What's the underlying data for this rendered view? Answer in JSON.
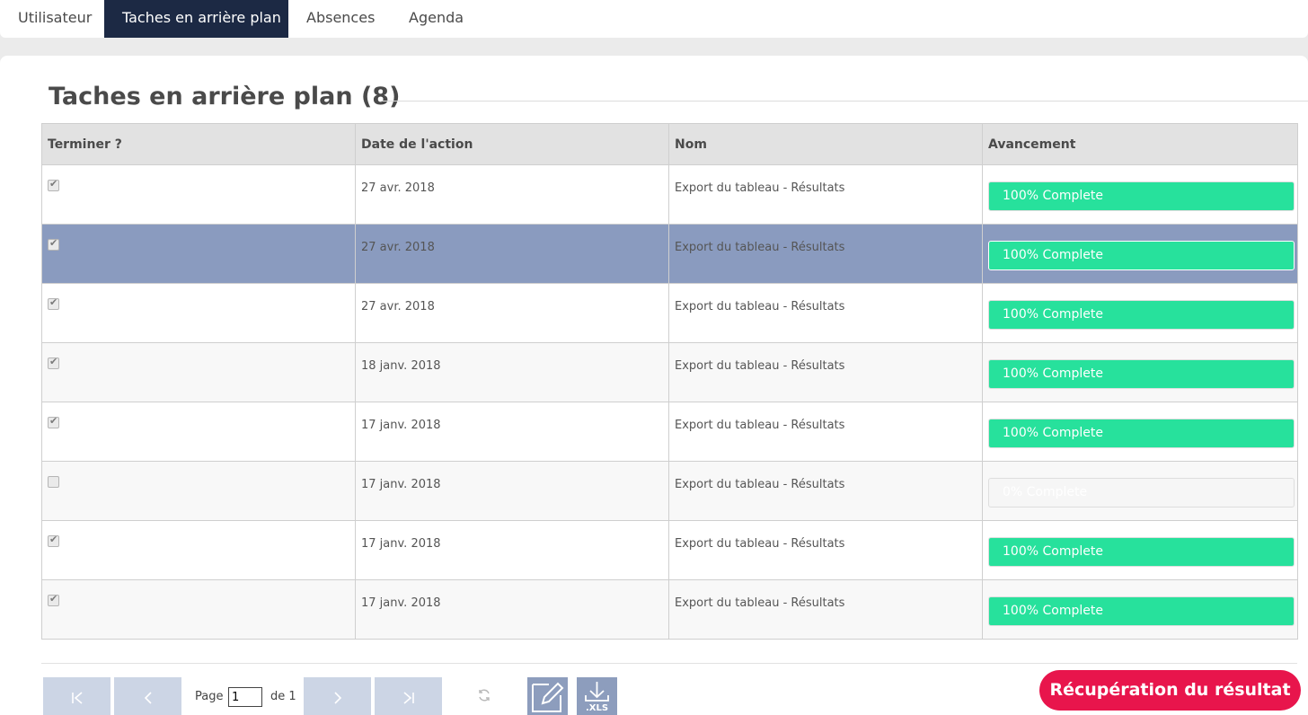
{
  "tabs": [
    {
      "label": "Utilisateur",
      "active": false
    },
    {
      "label": "Taches en arrière plan",
      "active": true
    },
    {
      "label": "Absences",
      "active": false
    },
    {
      "label": "Agenda",
      "active": false
    }
  ],
  "title": "Taches en arrière plan (8)",
  "table": {
    "columns": [
      "Terminer ?",
      "Date de l'action",
      "Nom",
      "Avancement"
    ],
    "rows": [
      {
        "done": true,
        "date": "27 avr. 2018",
        "name": "Export du tableau - Résultats",
        "progress": 100,
        "progress_label": "100% Complete"
      },
      {
        "done": true,
        "date": "27 avr. 2018",
        "name": "Export du tableau - Résultats",
        "progress": 100,
        "progress_label": "100% Complete",
        "selected": true
      },
      {
        "done": true,
        "date": "27 avr. 2018",
        "name": "Export du tableau - Résultats",
        "progress": 100,
        "progress_label": "100% Complete"
      },
      {
        "done": true,
        "date": "18 janv. 2018",
        "name": "Export du tableau - Résultats",
        "progress": 100,
        "progress_label": "100% Complete"
      },
      {
        "done": true,
        "date": "17 janv. 2018",
        "name": "Export du tableau - Résultats",
        "progress": 100,
        "progress_label": "100% Complete"
      },
      {
        "done": false,
        "date": "17 janv. 2018",
        "name": "Export du tableau - Résultats",
        "progress": 0,
        "progress_label": "0% Complete"
      },
      {
        "done": true,
        "date": "17 janv. 2018",
        "name": "Export du tableau - Résultats",
        "progress": 100,
        "progress_label": "100% Complete"
      },
      {
        "done": true,
        "date": "17 janv. 2018",
        "name": "Export du tableau - Résultats",
        "progress": 100,
        "progress_label": "100% Complete"
      }
    ]
  },
  "pager": {
    "page_label": "Page",
    "page_value": "1",
    "of_label": "de 1",
    "first_icon": "first-page-icon",
    "prev_icon": "prev-page-icon",
    "next_icon": "next-page-icon",
    "last_icon": "last-page-icon",
    "refresh_icon": "refresh-icon"
  },
  "tools": {
    "edit_icon": "edit-icon",
    "export_icon": "download-xls-icon",
    "export_label": ".XLS"
  },
  "action_button": "Récupération du résultat",
  "colors": {
    "active_tab": "#1c2944",
    "progress": "#27e19c",
    "selected_row": "#8a9bbf",
    "cta": "#e8154c",
    "pager_button": "#ccd5e5",
    "tool_button": "#8d9dbd"
  }
}
